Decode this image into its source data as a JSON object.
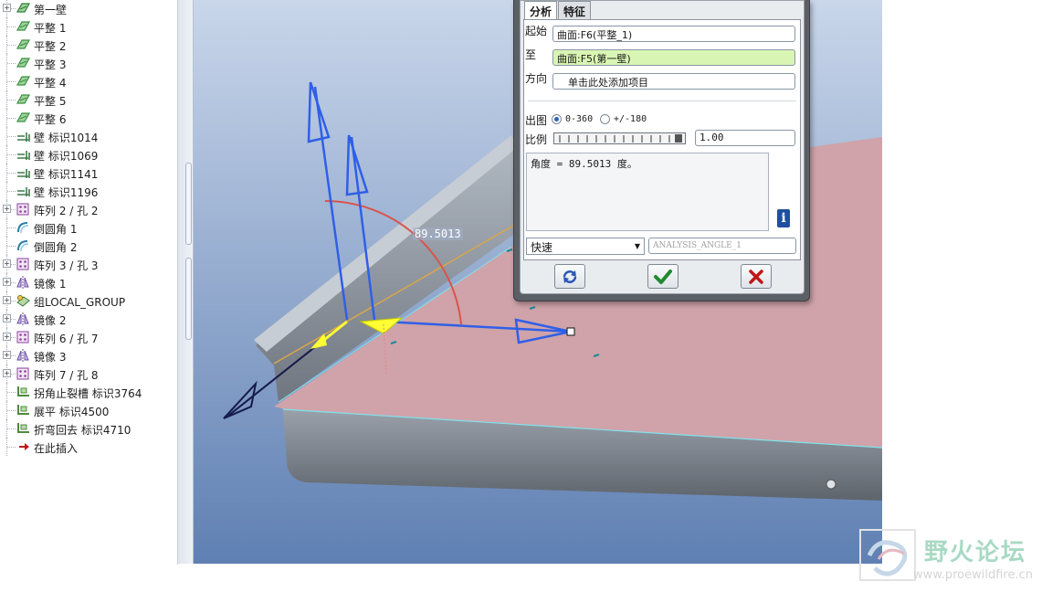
{
  "tree": {
    "items": [
      {
        "label": "第一壁",
        "icon": "wall-icon",
        "expander": "+"
      },
      {
        "label": "平整 1",
        "icon": "flat-icon"
      },
      {
        "label": "平整 2",
        "icon": "flat-icon"
      },
      {
        "label": "平整 3",
        "icon": "flat-icon"
      },
      {
        "label": "平整 4",
        "icon": "flat-icon"
      },
      {
        "label": "平整 5",
        "icon": "flat-icon"
      },
      {
        "label": "平整 6",
        "icon": "flat-icon"
      },
      {
        "label": "壁 标识1014",
        "icon": "flange-wall-icon"
      },
      {
        "label": "壁 标识1069",
        "icon": "flange-wall-icon"
      },
      {
        "label": "壁 标识1141",
        "icon": "flange-wall-icon"
      },
      {
        "label": "壁 标识1196",
        "icon": "flange-wall-icon"
      },
      {
        "label": "阵列 2 / 孔 2",
        "icon": "pattern-icon",
        "expander": "+"
      },
      {
        "label": "倒圆角 1",
        "icon": "round-icon"
      },
      {
        "label": "倒圆角 2",
        "icon": "round-icon"
      },
      {
        "label": "阵列 3 / 孔 3",
        "icon": "pattern-icon",
        "expander": "+"
      },
      {
        "label": "镜像 1",
        "icon": "mirror-icon",
        "expander": "+"
      },
      {
        "label": "组LOCAL_GROUP",
        "icon": "group-icon",
        "expander": "+"
      },
      {
        "label": "镜像 2",
        "icon": "mirror-icon",
        "expander": "+"
      },
      {
        "label": "阵列 6 / 孔 7",
        "icon": "pattern-icon",
        "expander": "+"
      },
      {
        "label": "镜像 3",
        "icon": "mirror-icon",
        "expander": "+"
      },
      {
        "label": "阵列 7 / 孔 8",
        "icon": "pattern-icon",
        "expander": "+"
      },
      {
        "label": "拐角止裂槽 标识3764",
        "icon": "corner-relief-icon"
      },
      {
        "label": "展平 标识4500",
        "icon": "unbend-icon"
      },
      {
        "label": "折弯回去 标识4710",
        "icon": "bend-back-icon"
      },
      {
        "label": "在此插入",
        "icon": "insert-here-arrow-icon"
      }
    ]
  },
  "viewport": {
    "angle_annotation": "89.5013"
  },
  "dialog": {
    "tabs": [
      "分析",
      "特征"
    ],
    "from_label": "起始",
    "from_value": "曲面:F6(平整_1)",
    "to_label": "至",
    "to_value": "曲面:F5(第一壁)",
    "direction_label": "方向",
    "direction_value": "单击此处添加项目",
    "output_label": "出图",
    "radio_0_360": "0-360",
    "radio_pm180": "+/-180",
    "ratio_label": "比例",
    "ratio_value": "1.00",
    "result_text": "角度 = 89.5013 度。",
    "mode_select": "快速",
    "analysis_name_placeholder": "ANALYSIS_ANGLE_1",
    "info_glyph": "i"
  },
  "watermark": {
    "title": "野火论坛",
    "url": "www.proewildfire.cn"
  },
  "colors": {
    "vector_blue": "#2f5fe8",
    "arc_red": "#d9544d",
    "yellow_marker": "#ffff33",
    "plate_pink": "#cfa3a9",
    "background_blue": "#7f9fc9"
  }
}
